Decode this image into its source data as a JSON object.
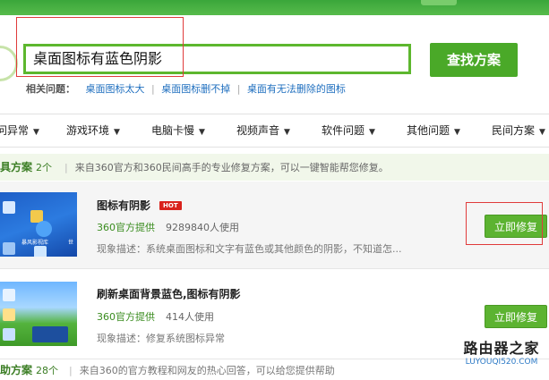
{
  "search": {
    "query": "桌面图标有蓝色阴影",
    "button_label": "查找方案"
  },
  "related": {
    "label": "相关问题：",
    "links": [
      "桌面图标太大",
      "桌面图标删不掉",
      "桌面有无法删除的图标"
    ],
    "separator": "|"
  },
  "tabs": [
    {
      "label": "问异常"
    },
    {
      "label": "游戏环境"
    },
    {
      "label": "电脑卡慢"
    },
    {
      "label": "视频声音"
    },
    {
      "label": "软件问题"
    },
    {
      "label": "其他问题"
    },
    {
      "label": "民间方案"
    }
  ],
  "tab_caret": "▼",
  "section1": {
    "title": "具方案",
    "count": "2个",
    "separator": "|",
    "description": "来自360官方和360民间高手的专业修复方案，可以一键智能帮您修复。"
  },
  "items": [
    {
      "title": "图标有阴影",
      "badge": "HOT",
      "source": "360官方提供",
      "users": "9289840人使用",
      "description": "现象描述：系统桌面图标和文字有蓝色或其他颜色的阴影，不知道怎...",
      "button_label": "立即修复",
      "thumb_label": "暴风影视库",
      "thumb_label_2": "世"
    },
    {
      "title": "刷新桌面背景蓝色,图标有阴影",
      "source": "360官方提供",
      "users": "414人使用",
      "description": "现象描述：修复系统图标异常",
      "button_label": "立即修复"
    }
  ],
  "section2": {
    "title": "助方案",
    "count": "28个",
    "separator": "|",
    "description": "来自360的官方教程和网友的热心回答，可以给您提供帮助"
  },
  "watermark": {
    "cn": "路由器之家",
    "en": "LUYOUQI520.COM"
  },
  "colors": {
    "accent_green": "#4aa928",
    "link_blue": "#1f6fbf",
    "hot_red": "#d9221c",
    "highlight_red": "#e03b3b"
  }
}
